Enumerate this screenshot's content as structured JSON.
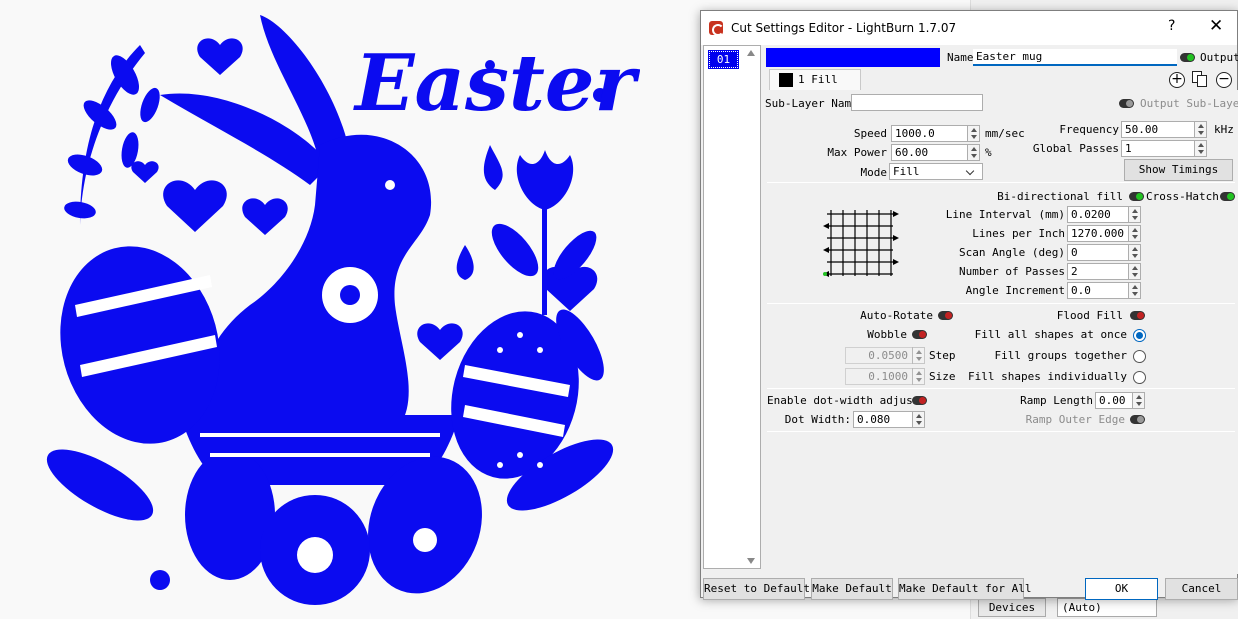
{
  "window": {
    "title": "Cut Settings Editor - LightBurn 1.7.07",
    "help": "?",
    "close": "✕"
  },
  "layer_list": {
    "items": [
      "01"
    ]
  },
  "header": {
    "name_label": "Name",
    "name_value": "Easter mug",
    "output_label": "Output",
    "tab_label": "1 Fill"
  },
  "sublayer": {
    "label": "Sub-Layer Name",
    "value": "",
    "output_sublayer_label": "Output Sub-Layer"
  },
  "speed": {
    "label": "Speed",
    "value": "1000.0",
    "unit": "mm/sec"
  },
  "max_power": {
    "label": "Max Power",
    "value": "60.00",
    "unit": "%"
  },
  "mode": {
    "label": "Mode",
    "value": "Fill"
  },
  "frequency": {
    "label": "Frequency",
    "value": "50.00",
    "unit": "kHz"
  },
  "global_passes": {
    "label": "Global Passes",
    "value": "1"
  },
  "show_timings": "Show Timings",
  "fill": {
    "bidirectional_label": "Bi-directional fill",
    "crosshatch_label": "Cross-Hatch",
    "line_interval_label": "Line Interval (mm)",
    "line_interval": "0.0200",
    "lines_per_inch_label": "Lines per Inch",
    "lines_per_inch": "1270.000",
    "scan_angle_label": "Scan Angle (deg)",
    "scan_angle": "0",
    "num_passes_label": "Number of Passes",
    "num_passes": "2",
    "angle_increment_label": "Angle Increment",
    "angle_increment": "0.0"
  },
  "options": {
    "auto_rotate": "Auto-Rotate",
    "wobble": "Wobble",
    "step_value": "0.0500",
    "step_label": "Step",
    "size_value": "0.1000",
    "size_label": "Size",
    "flood_fill": "Flood Fill",
    "fill_all": "Fill all shapes at once",
    "fill_groups": "Fill groups together",
    "fill_individually": "Fill shapes individually"
  },
  "dot": {
    "enable_label": "Enable dot-width adjust",
    "dot_width_label": "Dot Width:",
    "dot_width": "0.080",
    "ramp_length_label": "Ramp Length",
    "ramp_length": "0.00",
    "ramp_outer_label": "Ramp Outer Edge"
  },
  "buttons": {
    "reset": "Reset to Default",
    "make_default": "Make Default",
    "make_default_all": "Make Default for All",
    "ok": "OK",
    "cancel": "Cancel"
  },
  "background": {
    "devices_label": "Devices",
    "devices_value": "(Auto)",
    "art_title": "Easter"
  },
  "colors": {
    "layer": "#0000ff",
    "art": "#0b0bf0",
    "accent": "#0067c0"
  }
}
